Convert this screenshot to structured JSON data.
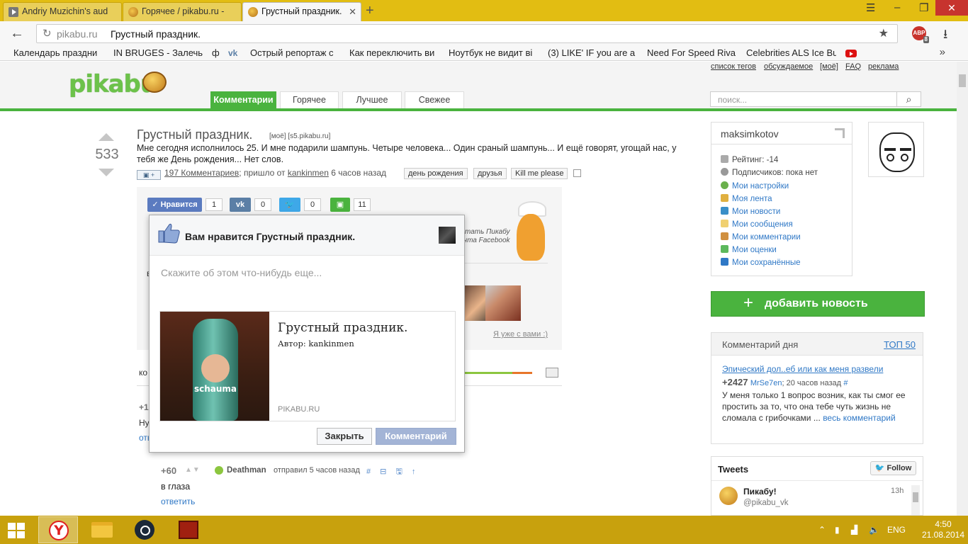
{
  "browser": {
    "tabs": [
      {
        "label": "Andriy Muzichin's aud"
      },
      {
        "label": "Горячее / pikabu.ru -"
      },
      {
        "label": "Грустный праздник."
      }
    ],
    "url_host": "pikabu.ru",
    "url_page": "Грустный праздник.",
    "abp_label": "ABP",
    "abp_count": "8",
    "bookmarks": [
      "Календарь праздни",
      "IN BRUGES - Залечь",
      "ф",
      "Острый репортаж с",
      "Как переключить ви",
      "Ноутбук не видит ві",
      "(3) LIKE' IF you are a",
      "Need For Speed Riva",
      "Celebrities ALS Ice Bu"
    ],
    "bookmarks_more": "»"
  },
  "site": {
    "logo": "pikabu",
    "top_links": [
      "список тегов",
      "обсуждаемое",
      "[моё]",
      "FAQ",
      "реклама"
    ],
    "tabs": [
      "Комментарии",
      "Горячее",
      "Лучшее",
      "Свежее"
    ],
    "search_placeholder": "поиск..."
  },
  "post": {
    "rating": "533",
    "title": "Грустный праздник.",
    "meta_small": "[моё] [s5.pikabu.ru]",
    "text": "Мне сегодня исполнилось 25. И мне подарили шампунь. Четыре человека... Один сраный шампунь... И ещё говорят, угощай нас, у тебя же День рождения... Нет слов.",
    "comments_link": "197 Комментариев",
    "posted_from": "; пришло от",
    "author": "kankinmen",
    "posted_ago": "6 часов назад",
    "tags": [
      "день рождения",
      "друзья",
      "Kill me please"
    ]
  },
  "share": {
    "like_label": "Нравится",
    "like_count": "1",
    "vk_count": "0",
    "twitter_count": "0",
    "save_count": "11",
    "promo_line1": "итать Пикабу",
    "promo_line2": "ента Facebook",
    "already": "Я уже с вами :)"
  },
  "fb_dialog": {
    "title": "Вам нравится Грустный праздник.",
    "placeholder": "Скажите об этом что-нибудь еще...",
    "card_title": "Грустный праздник.",
    "card_author": "Автор: kankinmen",
    "card_domain": "PIKABU.RU",
    "card_brand": "schauma",
    "close_label": "Закрыть",
    "comment_label": "Комментарий"
  },
  "comments_cut": {
    "a": "ко",
    "b": "+1",
    "c": "Ну",
    "d": "отв",
    "e": "в"
  },
  "comment": {
    "rating": "+60",
    "author": "Deathman",
    "when": "отправил 5 часов назад",
    "icons": "# ⊟ 🖫 ↑",
    "text": "в глаза",
    "reply": "ответить"
  },
  "user_box": {
    "username": "maksimkotov",
    "rating": "Рейтинг: -14",
    "subscribers": "Подписчиков: пока нет",
    "links": [
      "Мои настройки",
      "Моя лента",
      "Мои новости",
      "Мои сообщения",
      "Мои комментарии",
      "Мои оценки",
      "Мои сохранённые"
    ]
  },
  "add_news": "добавить новость",
  "comment_of_day": {
    "title": "Комментарий дня",
    "top": "ТОП 50",
    "link": "Эпический дол..еб или как меня развели",
    "score": "+2427",
    "user": "MrSe7en",
    "ago": "; 20 часов назад",
    "hash": "#",
    "body": "У меня только 1 вопрос возник, как ты смог ее простить за то, что она тебе чуть жизнь не сломала с грибочками ...",
    "more": "весь комментарий"
  },
  "tweets": {
    "title": "Tweets",
    "follow": "Follow",
    "name": "Пикабу!",
    "handle": "@pikabu_vk",
    "time": "13h"
  },
  "taskbar": {
    "lang": "ENG",
    "time": "4:50",
    "date": "21.08.2014"
  },
  "colors": {
    "brand_green": "#4ab33e",
    "taskbar": "#c8a10d",
    "link": "#2f78c6"
  }
}
